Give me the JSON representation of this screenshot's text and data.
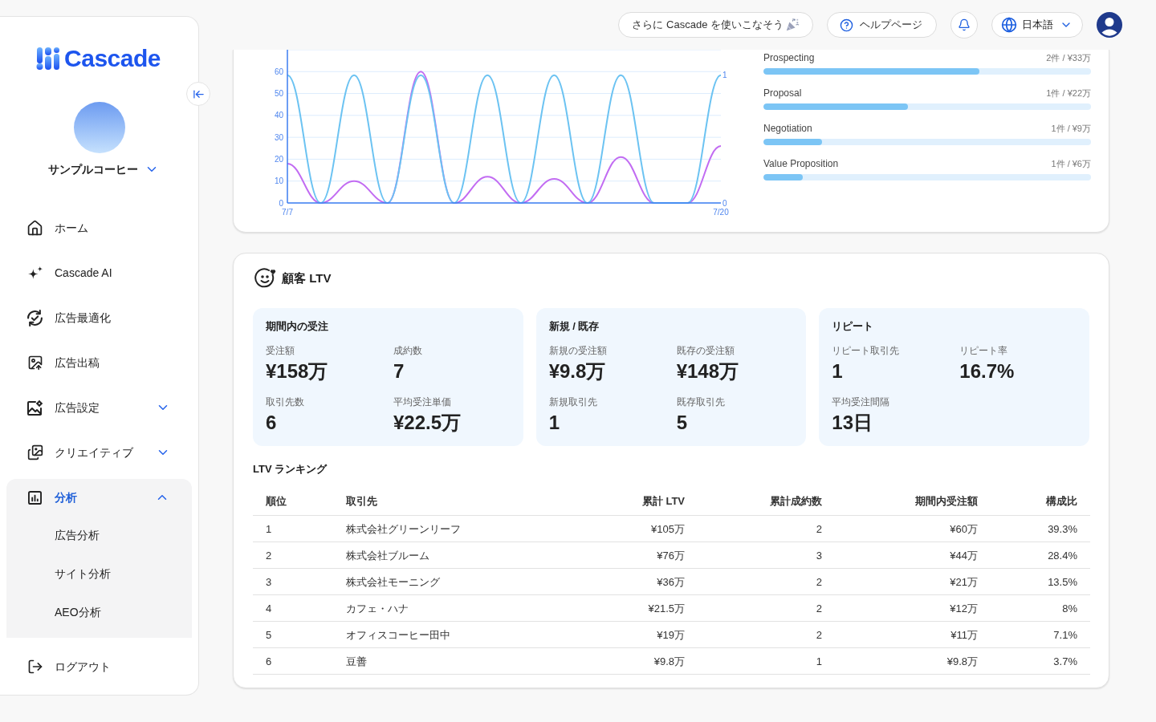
{
  "header": {
    "promo_button": "さらに Cascade を使いこなそう",
    "help_button": "ヘルプページ",
    "language": "日本語"
  },
  "sidebar": {
    "brand": "Cascade",
    "account": "サンプルコーヒー",
    "items": [
      {
        "label": "ホーム",
        "kind": "link",
        "selected": false
      },
      {
        "label": "Cascade AI",
        "kind": "link",
        "selected": false
      },
      {
        "label": "広告最適化",
        "kind": "link",
        "selected": false
      },
      {
        "label": "広告出稿",
        "kind": "link",
        "selected": false
      },
      {
        "label": "広告設定",
        "kind": "group",
        "selected": false,
        "expanded": false
      },
      {
        "label": "クリエイティブ",
        "kind": "group",
        "selected": false,
        "expanded": false
      },
      {
        "label": "分析",
        "kind": "group",
        "selected": true,
        "expanded": true,
        "children": [
          {
            "label": "広告分析",
            "selected": false
          },
          {
            "label": "サイト分析",
            "selected": false
          },
          {
            "label": "AEO分析",
            "selected": false
          }
        ]
      }
    ],
    "logout": "ログアウト"
  },
  "sales_chart": {
    "chart_data": {
      "type": "line",
      "categories": [
        "7/7",
        null,
        null,
        null,
        null,
        null,
        null,
        null,
        null,
        null,
        null,
        null,
        null,
        "7/20"
      ],
      "series": [
        {
          "color": "#c26cf2",
          "values": [
            18,
            0,
            10,
            0,
            60,
            0,
            12,
            0,
            11,
            0,
            21,
            0,
            0,
            26
          ]
        },
        {
          "color": "#6cc3f2",
          "axis": "y2",
          "values": [
            1,
            0,
            1,
            0,
            1,
            0,
            1,
            0,
            1,
            0,
            1,
            0,
            0,
            1
          ]
        }
      ],
      "ylim": [
        0,
        70
      ],
      "yticks": [
        0,
        10,
        20,
        30,
        40,
        50,
        60
      ],
      "y2lim": [
        0,
        1.2
      ],
      "y2ticks": [
        0,
        1
      ],
      "grid": true
    }
  },
  "pipeline": [
    {
      "stage": "Prospecting",
      "summary": "2件 / ¥33万",
      "level": 0.66
    },
    {
      "stage": "Proposal",
      "summary": "1件 / ¥22万",
      "level": 0.44
    },
    {
      "stage": "Negotiation",
      "summary": "1件 / ¥9万",
      "level": 0.18
    },
    {
      "stage": "Value Proposition",
      "summary": "1件 / ¥6万",
      "level": 0.12
    }
  ],
  "ltv": {
    "title": "顧客 LTV",
    "groups": [
      {
        "title": "期間内の受注",
        "stats": [
          {
            "label": "受注額",
            "value": "¥158万"
          },
          {
            "label": "成約数",
            "value": "7"
          },
          {
            "label": "取引先数",
            "value": "6"
          },
          {
            "label": "平均受注単価",
            "value": "¥22.5万"
          }
        ]
      },
      {
        "title": "新規 / 既存",
        "stats": [
          {
            "label": "新規の受注額",
            "value": "¥9.8万"
          },
          {
            "label": "既存の受注額",
            "value": "¥148万"
          },
          {
            "label": "新規取引先",
            "value": "1"
          },
          {
            "label": "既存取引先",
            "value": "5"
          }
        ]
      },
      {
        "title": "リピート",
        "stats": [
          {
            "label": "リピート取引先",
            "value": "1"
          },
          {
            "label": "リピート率",
            "value": "16.7%"
          },
          {
            "label": "平均受注間隔",
            "value": "13日"
          }
        ]
      }
    ],
    "ranking": {
      "title": "LTV ランキング",
      "columns": [
        "順位",
        "取引先",
        "累計 LTV",
        "累計成約数",
        "期間内受注額",
        "構成比"
      ],
      "rows": [
        [
          "1",
          "株式会社グリーンリーフ",
          "¥105万",
          "2",
          "¥60万",
          "39.3%"
        ],
        [
          "2",
          "株式会社ブルーム",
          "¥76万",
          "3",
          "¥44万",
          "28.4%"
        ],
        [
          "3",
          "株式会社モーニング",
          "¥36万",
          "2",
          "¥21万",
          "13.5%"
        ],
        [
          "4",
          "カフェ・ハナ",
          "¥21.5万",
          "2",
          "¥12万",
          "8%"
        ],
        [
          "5",
          "オフィスコーヒー田中",
          "¥19万",
          "2",
          "¥11万",
          "7.1%"
        ],
        [
          "6",
          "豆善",
          "¥9.8万",
          "1",
          "¥9.8万",
          "3.7%"
        ]
      ]
    }
  }
}
